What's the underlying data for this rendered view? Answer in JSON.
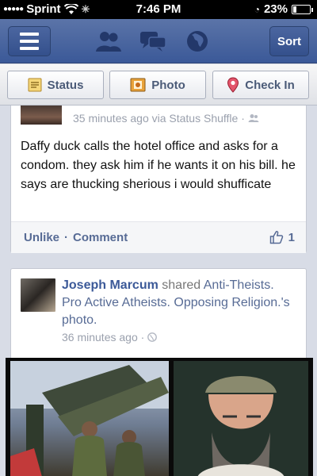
{
  "status_bar": {
    "carrier": "Sprint",
    "time": "7:46 PM",
    "battery": "23%",
    "battery_level": 0.23
  },
  "navbar": {
    "sort_label": "Sort",
    "icons": [
      "menu-icon",
      "friends-icon",
      "messages-icon",
      "globe-icon"
    ]
  },
  "actions": {
    "status_label": "Status",
    "photo_label": "Photo",
    "checkin_label": "Check In"
  },
  "posts": [
    {
      "meta": "35 minutes ago via Status Shuffle ·",
      "text": "Daffy duck calls the hotel office and asks for a condom. they ask him if he wants it on his bill. he says are thucking sherious i would shufficate",
      "unlike_label": "Unlike",
      "comment_label": "Comment",
      "likes": "1"
    },
    {
      "author": "Joseph Marcum",
      "verb": "shared",
      "target": "Anti-Theists. Pro Active Atheists. Opposing Religion.'s photo.",
      "meta": "36 minutes ago ·"
    }
  ],
  "colors": {
    "brand": "#3b5998",
    "link": "#576b95",
    "background": "#d8dce6"
  }
}
